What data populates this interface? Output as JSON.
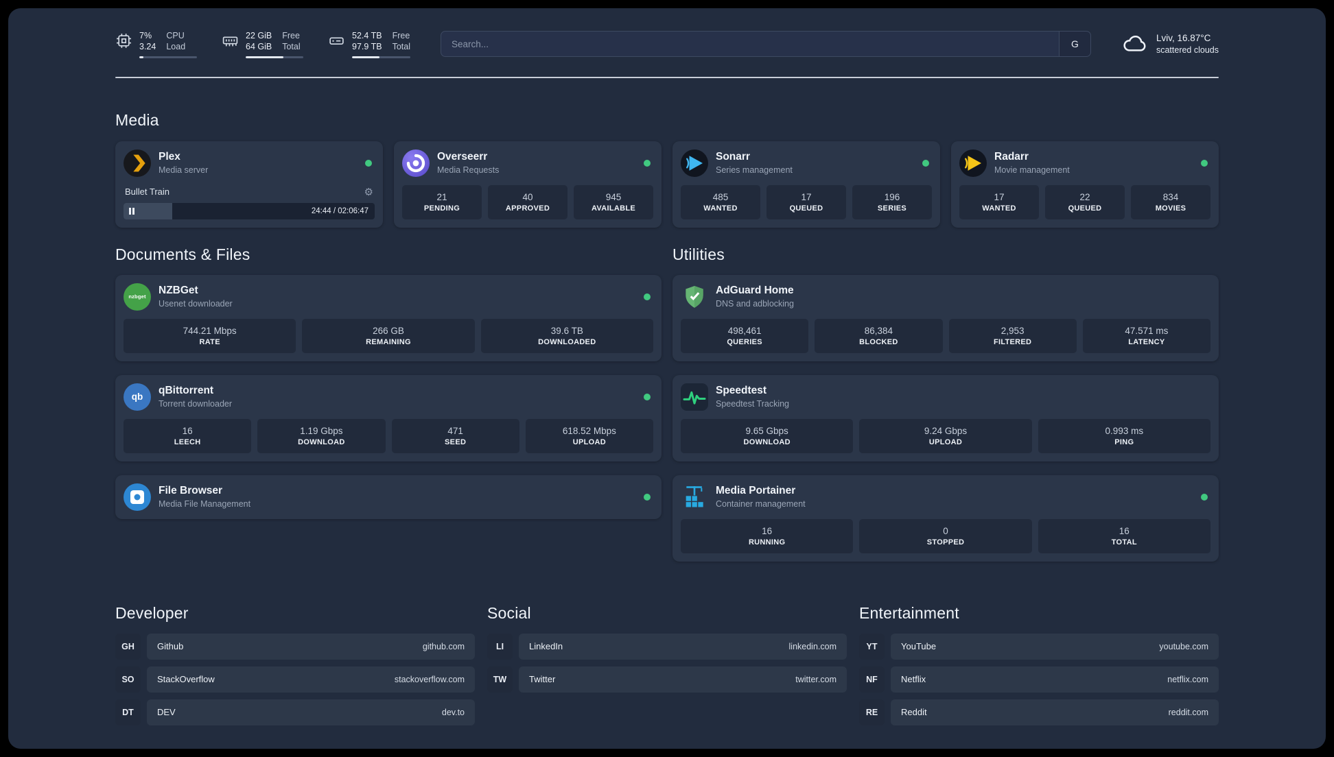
{
  "colors": {
    "status_online": "#41c980",
    "plex_accent": "#e5a00d",
    "sonarr_accent": "#3fb6f0",
    "radarr_accent": "#f5c518",
    "speedtest_accent": "#2fd07e",
    "portainer_accent": "#28aae1"
  },
  "topbar": {
    "cpu": {
      "percent": "7%",
      "load": "3.24",
      "label_top": "CPU",
      "label_bottom": "Load",
      "bar_percent": 7
    },
    "ram": {
      "free": "22 GiB",
      "total": "64 GiB",
      "label_top": "Free",
      "label_bottom": "Total",
      "bar_percent": 66
    },
    "disk": {
      "free": "52.4 TB",
      "total": "97.9 TB",
      "label_top": "Free",
      "label_bottom": "Total",
      "bar_percent": 47
    },
    "search": {
      "placeholder": "Search...",
      "button_label": "G"
    },
    "weather": {
      "location": "Lviv, 16.87°C",
      "condition": "scattered clouds"
    }
  },
  "media": {
    "title": "Media",
    "plex": {
      "name": "Plex",
      "subtitle": "Media server",
      "track": "Bullet Train",
      "time": "24:44 / 02:06:47",
      "progress_percent": 19.5
    },
    "overseerr": {
      "name": "Overseerr",
      "subtitle": "Media Requests",
      "stats": [
        {
          "value": "21",
          "label": "PENDING"
        },
        {
          "value": "40",
          "label": "APPROVED"
        },
        {
          "value": "945",
          "label": "AVAILABLE"
        }
      ]
    },
    "sonarr": {
      "name": "Sonarr",
      "subtitle": "Series management",
      "stats": [
        {
          "value": "485",
          "label": "WANTED"
        },
        {
          "value": "17",
          "label": "QUEUED"
        },
        {
          "value": "196",
          "label": "SERIES"
        }
      ]
    },
    "radarr": {
      "name": "Radarr",
      "subtitle": "Movie management",
      "stats": [
        {
          "value": "17",
          "label": "WANTED"
        },
        {
          "value": "22",
          "label": "QUEUED"
        },
        {
          "value": "834",
          "label": "MOVIES"
        }
      ]
    }
  },
  "documents": {
    "title": "Documents & Files",
    "nzbget": {
      "name": "NZBGet",
      "subtitle": "Usenet downloader",
      "icon_text": "nzbget",
      "stats": [
        {
          "value": "744.21 Mbps",
          "label": "RATE"
        },
        {
          "value": "266 GB",
          "label": "REMAINING"
        },
        {
          "value": "39.6 TB",
          "label": "DOWNLOADED"
        }
      ]
    },
    "qbittorrent": {
      "name": "qBittorrent",
      "subtitle": "Torrent downloader",
      "icon_text": "qb",
      "stats": [
        {
          "value": "16",
          "label": "LEECH"
        },
        {
          "value": "1.19 Gbps",
          "label": "DOWNLOAD"
        },
        {
          "value": "471",
          "label": "SEED"
        },
        {
          "value": "618.52 Mbps",
          "label": "UPLOAD"
        }
      ]
    },
    "filebrowser": {
      "name": "File Browser",
      "subtitle": "Media File Management"
    }
  },
  "utilities": {
    "title": "Utilities",
    "adguard": {
      "name": "AdGuard Home",
      "subtitle": "DNS and adblocking",
      "stats": [
        {
          "value": "498,461",
          "label": "QUERIES"
        },
        {
          "value": "86,384",
          "label": "BLOCKED"
        },
        {
          "value": "2,953",
          "label": "FILTERED"
        },
        {
          "value": "47.571 ms",
          "label": "LATENCY"
        }
      ]
    },
    "speedtest": {
      "name": "Speedtest",
      "subtitle": "Speedtest Tracking",
      "stats": [
        {
          "value": "9.65 Gbps",
          "label": "DOWNLOAD"
        },
        {
          "value": "9.24 Gbps",
          "label": "UPLOAD"
        },
        {
          "value": "0.993 ms",
          "label": "PING"
        }
      ]
    },
    "portainer": {
      "name": "Media Portainer",
      "subtitle": "Container management",
      "stats": [
        {
          "value": "16",
          "label": "RUNNING"
        },
        {
          "value": "0",
          "label": "STOPPED"
        },
        {
          "value": "16",
          "label": "TOTAL"
        }
      ]
    }
  },
  "links": {
    "developer": {
      "title": "Developer",
      "items": [
        {
          "abbr": "GH",
          "label": "Github",
          "url": "github.com"
        },
        {
          "abbr": "SO",
          "label": "StackOverflow",
          "url": "stackoverflow.com"
        },
        {
          "abbr": "DT",
          "label": "DEV",
          "url": "dev.to"
        }
      ]
    },
    "social": {
      "title": "Social",
      "items": [
        {
          "abbr": "LI",
          "label": "LinkedIn",
          "url": "linkedin.com"
        },
        {
          "abbr": "TW",
          "label": "Twitter",
          "url": "twitter.com"
        }
      ]
    },
    "entertainment": {
      "title": "Entertainment",
      "items": [
        {
          "abbr": "YT",
          "label": "YouTube",
          "url": "youtube.com"
        },
        {
          "abbr": "NF",
          "label": "Netflix",
          "url": "netflix.com"
        },
        {
          "abbr": "RE",
          "label": "Reddit",
          "url": "reddit.com"
        }
      ]
    }
  }
}
